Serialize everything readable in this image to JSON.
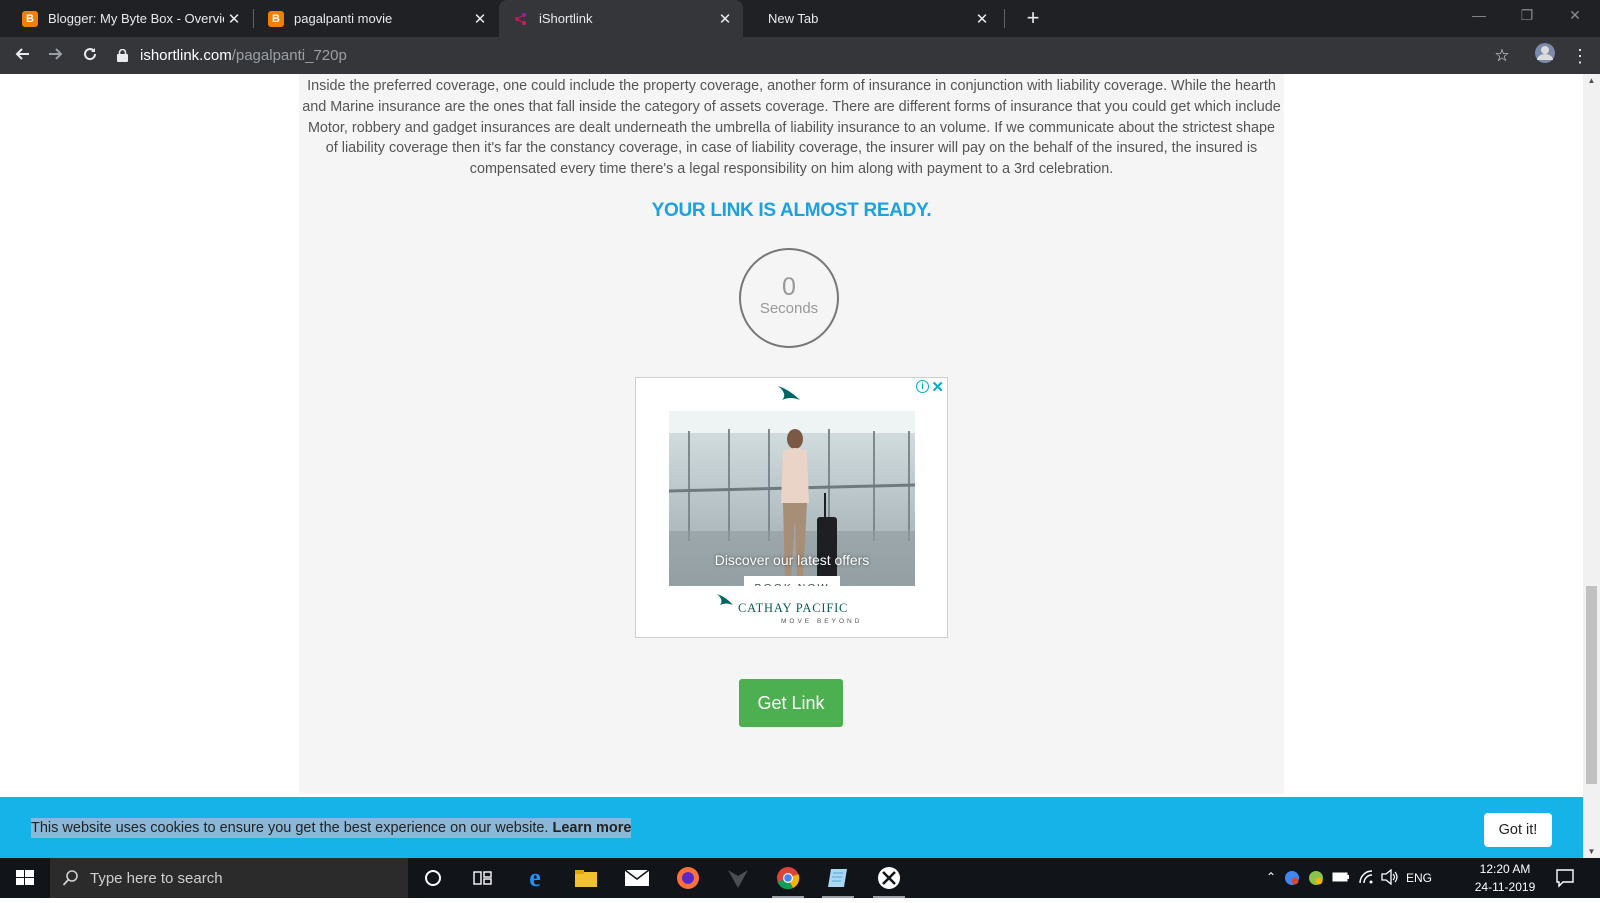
{
  "browser": {
    "tabs": [
      {
        "title": "Blogger: My Byte Box - Overview",
        "favicon": "blogger-icon",
        "active": false
      },
      {
        "title": "pagalpanti movie",
        "favicon": "blogger-icon",
        "active": false
      },
      {
        "title": "iShortlink",
        "favicon": "ishortlink-icon",
        "active": true
      },
      {
        "title": "New Tab",
        "favicon": "",
        "active": false
      }
    ],
    "url_host": "ishortlink.com",
    "url_path": "/pagalpanti_720p"
  },
  "page": {
    "article_text": "Inside the preferred coverage, one could include the property coverage, another form of insurance in conjunction with liability coverage. While the hearth and Marine insurance are the ones that fall inside the category of assets coverage. There are different forms of insurance that you could get which include Motor, robbery and gadget insurances are dealt underneath the umbrella of liability insurance to an volume. If we communicate about the strictest shape of liability coverage then it's far the constancy coverage, in case of liability coverage, the insurer will pay on the behalf of the insured, the insured is compensated every time there's a legal responsibility on him along with payment to a 3rd celebration.",
    "ready_heading": "YOUR LINK IS ALMOST READY.",
    "timer_value": "0",
    "timer_label": "Seconds",
    "get_link_label": "Get Link",
    "accent_color": "#1ba1e2",
    "button_color": "#4caf50"
  },
  "ad": {
    "headline": "Discover our latest offers",
    "cta": "BOOK NOW",
    "brand": "CATHAY PACIFIC",
    "tagline": "MOVE BEYOND"
  },
  "cookie_bar": {
    "message": "This website uses cookies to ensure you get the best experience on our website.",
    "learn_more": "Learn more",
    "accept_label": "Got it!",
    "bar_color": "#16b3e8"
  },
  "taskbar": {
    "search_placeholder": "Type here to search",
    "language": "ENG",
    "time": "12:20 AM",
    "date": "24-11-2019"
  }
}
